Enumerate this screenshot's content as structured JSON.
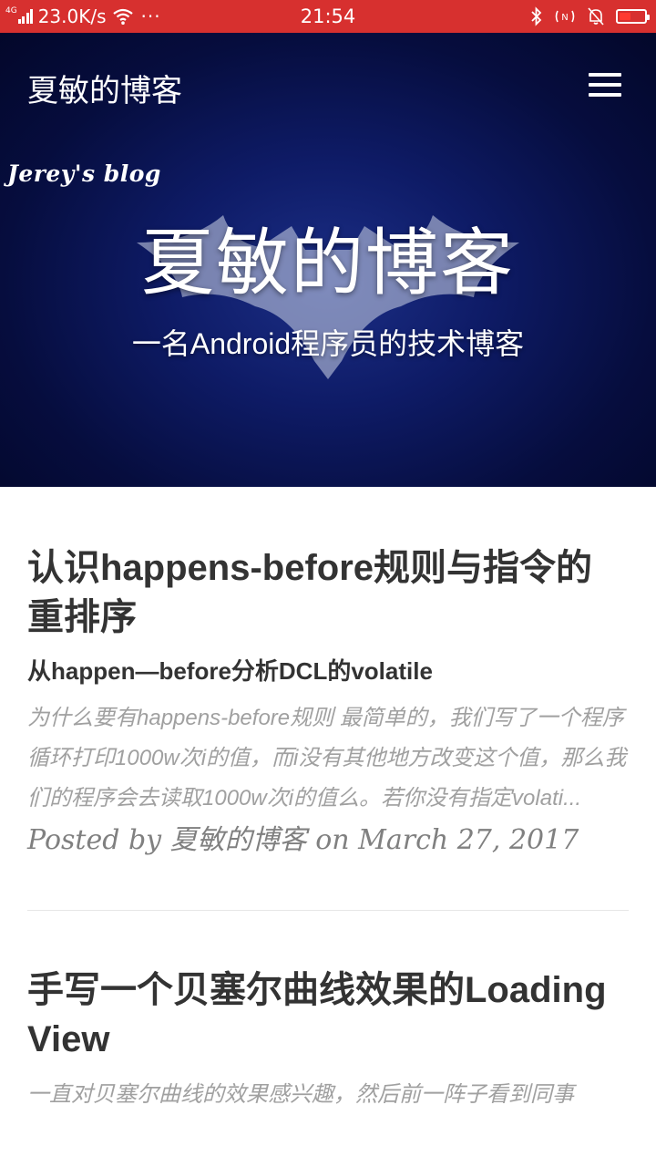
{
  "status_bar": {
    "network_type": "4G",
    "speed": "23.0K/s",
    "more": "···",
    "time": "21:54",
    "battery_level_percent": 40,
    "battery_color": "#ff3b30",
    "icons": [
      "signal-icon",
      "wifi-icon",
      "bluetooth-icon",
      "nfc-icon",
      "mute-icon",
      "battery-icon"
    ]
  },
  "header": {
    "brand": "夏敏的博客",
    "menu_icon": "hamburger-menu-icon"
  },
  "hero": {
    "script_label": "Jerey's blog",
    "title": "夏敏的博客",
    "subtitle": "一名Android程序员的技术博客"
  },
  "posts": [
    {
      "title": "认识happens-before规则与指令的重排序",
      "subtitle": "从happen—before分析DCL的volatile",
      "excerpt": "为什么要有happens-before规则 最简单的，我们写了一个程序循环打印1000w次i的值，而i没有其他地方改变这个值，那么我们的程序会去读取1000w次i的值么。若你没有指定volati...",
      "meta": "Posted by 夏敏的博客 on March 27, 2017"
    },
    {
      "title": "手写一个贝塞尔曲线效果的Loading View",
      "excerpt": "一直对贝塞尔曲线的效果感兴趣，然后前一阵子看到同事"
    }
  ],
  "colors": {
    "status_bar": "#d7302f",
    "hero_dark": "#060d3e",
    "title_text": "#333333",
    "excerpt_text": "#a0a0a0",
    "meta_text": "#808080"
  }
}
